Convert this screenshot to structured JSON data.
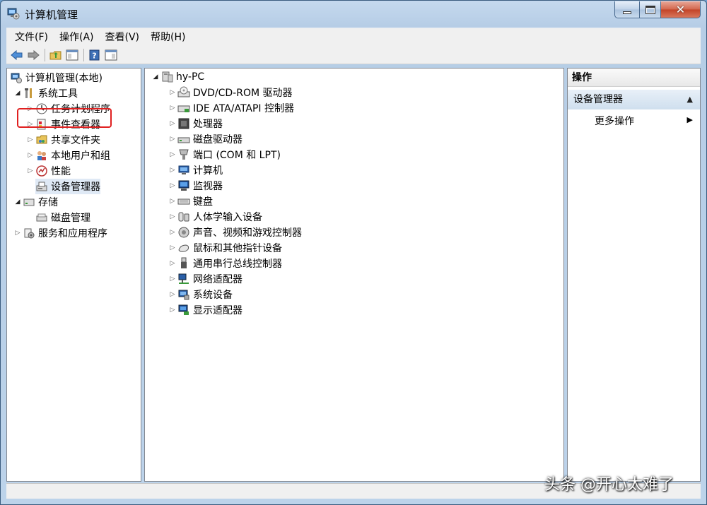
{
  "window": {
    "title": "计算机管理"
  },
  "menu": [
    "文件(F)",
    "操作(A)",
    "查看(V)",
    "帮助(H)"
  ],
  "toolbar": [
    "back-arrow-icon",
    "forward-arrow-icon",
    "up-folder-icon",
    "show-hide-tree-icon",
    "help-icon",
    "properties-icon"
  ],
  "left_tree": {
    "root": "计算机管理(本地)",
    "system_tools": "系统工具",
    "task_scheduler": "任务计划程序",
    "event_viewer": "事件查看器",
    "shared_folders": "共享文件夹",
    "local_users": "本地用户和组",
    "performance": "性能",
    "device_manager": "设备管理器",
    "storage": "存储",
    "disk_management": "磁盘管理",
    "services": "服务和应用程序"
  },
  "center_tree": {
    "root": "hy-PC",
    "devices": [
      "DVD/CD-ROM 驱动器",
      "IDE ATA/ATAPI 控制器",
      "处理器",
      "磁盘驱动器",
      "端口 (COM 和 LPT)",
      "计算机",
      "监视器",
      "键盘",
      "人体学输入设备",
      "声音、视频和游戏控制器",
      "鼠标和其他指针设备",
      "通用串行总线控制器",
      "网络适配器",
      "系统设备",
      "显示适配器"
    ]
  },
  "actions": {
    "header": "操作",
    "section": "设备管理器",
    "more": "更多操作"
  },
  "watermark": "头条 @开心太难了",
  "colors": {
    "highlight_box": "#e02020",
    "titlebar": "#c5d9ee"
  }
}
